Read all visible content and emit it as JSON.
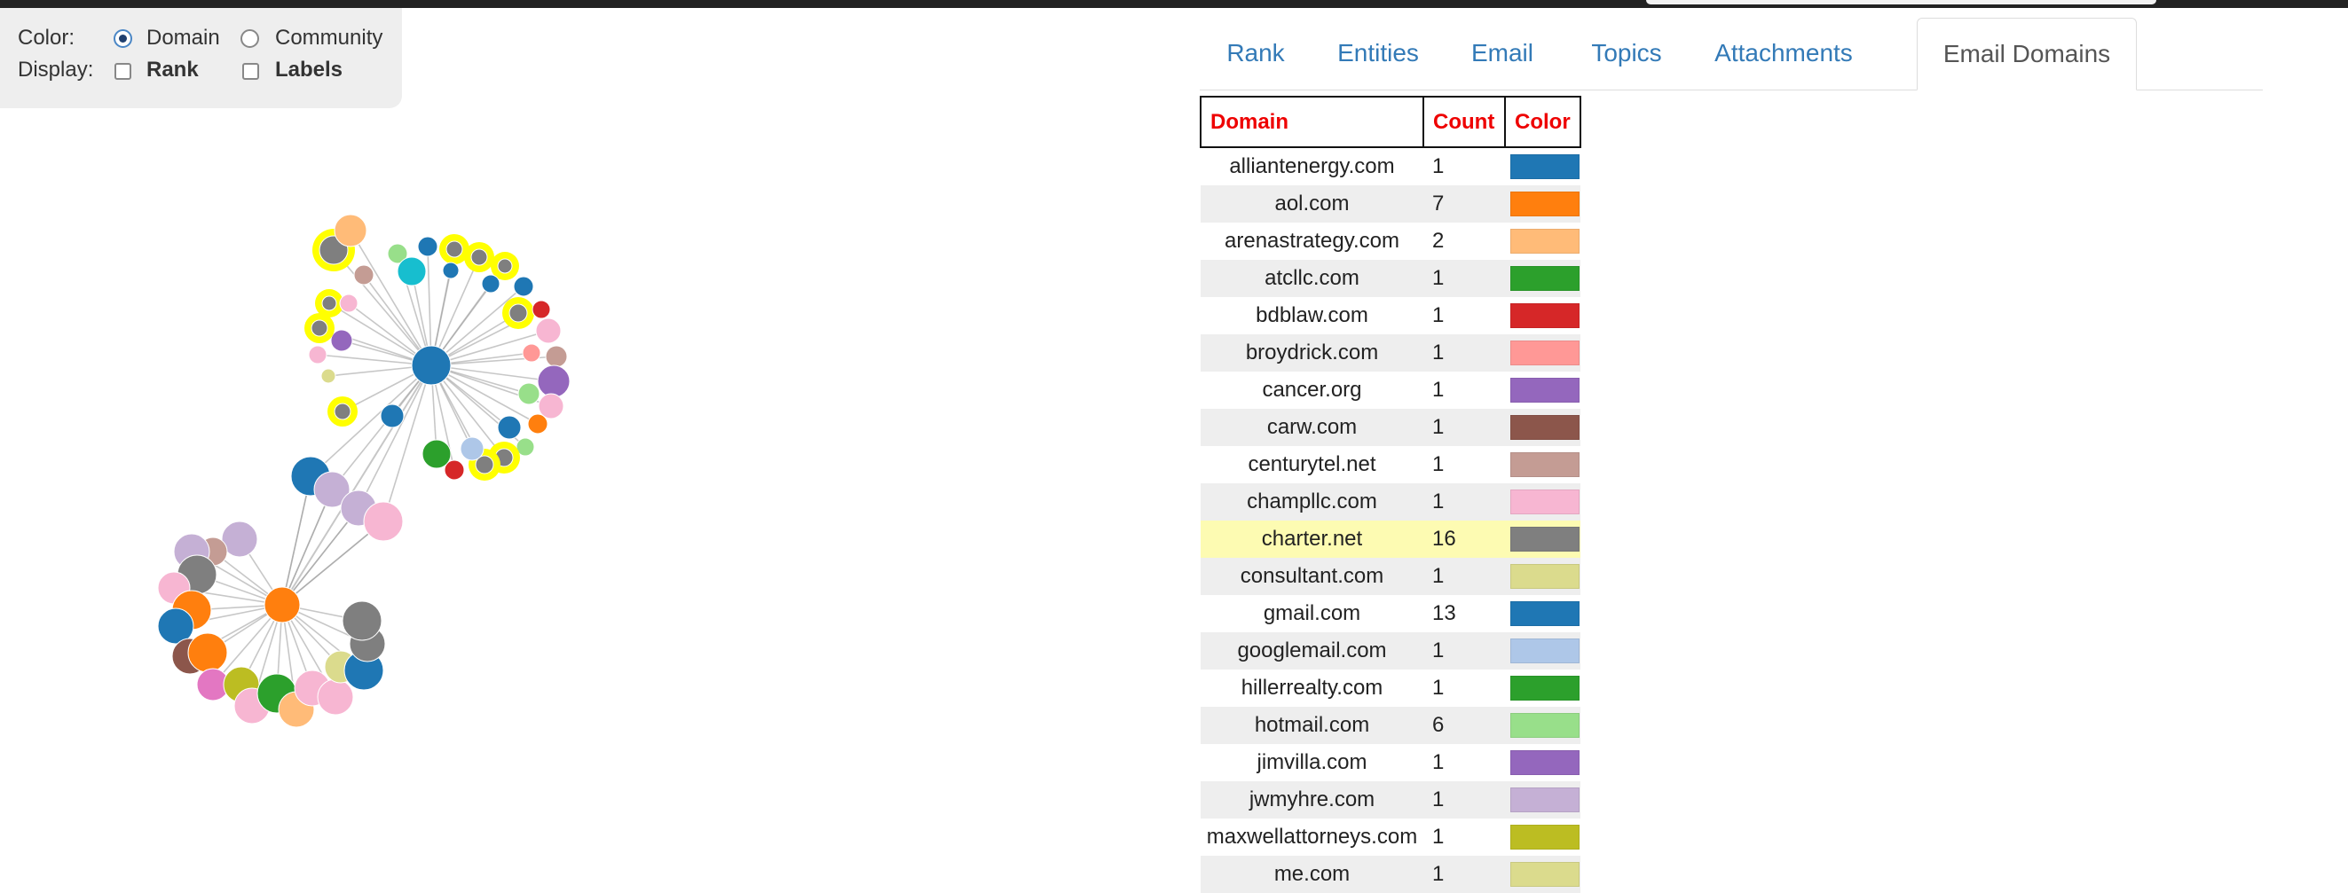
{
  "controls": {
    "color_label": "Color:",
    "display_label": "Display:",
    "color_options": [
      {
        "label": "Domain",
        "checked": true
      },
      {
        "label": "Community",
        "checked": false
      }
    ],
    "display_options": [
      {
        "label": "Rank",
        "checked": false
      },
      {
        "label": "Labels",
        "checked": false
      }
    ]
  },
  "tabs": [
    {
      "label": "Rank",
      "active": false
    },
    {
      "label": "Entities",
      "active": false
    },
    {
      "label": "Email",
      "active": false
    },
    {
      "label": "Topics",
      "active": false
    },
    {
      "label": "Attachments",
      "active": false
    },
    {
      "label": "Email Domains",
      "active": true
    }
  ],
  "domain_table": {
    "headers": {
      "domain": "Domain",
      "count": "Count",
      "color": "Color"
    },
    "highlighted_domain": "charter.net",
    "rows": [
      {
        "domain": "alliantenergy.com",
        "count": "1",
        "color": "#1f77b4"
      },
      {
        "domain": "aol.com",
        "count": "7",
        "color": "#ff7f0e"
      },
      {
        "domain": "arenastrategy.com",
        "count": "2",
        "color": "#ffbb78"
      },
      {
        "domain": "atcllc.com",
        "count": "1",
        "color": "#2ca02c"
      },
      {
        "domain": "bdblaw.com",
        "count": "1",
        "color": "#d62728"
      },
      {
        "domain": "broydrick.com",
        "count": "1",
        "color": "#ff9896"
      },
      {
        "domain": "cancer.org",
        "count": "1",
        "color": "#9467bd"
      },
      {
        "domain": "carw.com",
        "count": "1",
        "color": "#8c564b"
      },
      {
        "domain": "centurytel.net",
        "count": "1",
        "color": "#c49c94"
      },
      {
        "domain": "champllc.com",
        "count": "1",
        "color": "#f7b6d2"
      },
      {
        "domain": "charter.net",
        "count": "16",
        "color": "#7f7f7f"
      },
      {
        "domain": "consultant.com",
        "count": "1",
        "color": "#dbdb8d"
      },
      {
        "domain": "gmail.com",
        "count": "13",
        "color": "#1f77b4"
      },
      {
        "domain": "googlemail.com",
        "count": "1",
        "color": "#aec7e8"
      },
      {
        "domain": "hillerrealty.com",
        "count": "1",
        "color": "#2ca02c"
      },
      {
        "domain": "hotmail.com",
        "count": "6",
        "color": "#98df8a"
      },
      {
        "domain": "jimvilla.com",
        "count": "1",
        "color": "#9467bd"
      },
      {
        "domain": "jwmyhre.com",
        "count": "1",
        "color": "#c5b0d5"
      },
      {
        "domain": "maxwellattorneys.com",
        "count": "1",
        "color": "#bcbd22"
      },
      {
        "domain": "me.com",
        "count": "1",
        "color": "#dbdb8d"
      }
    ]
  },
  "graph": {
    "highlight_color": "#ffff00",
    "edge_color": "#999999"
  }
}
